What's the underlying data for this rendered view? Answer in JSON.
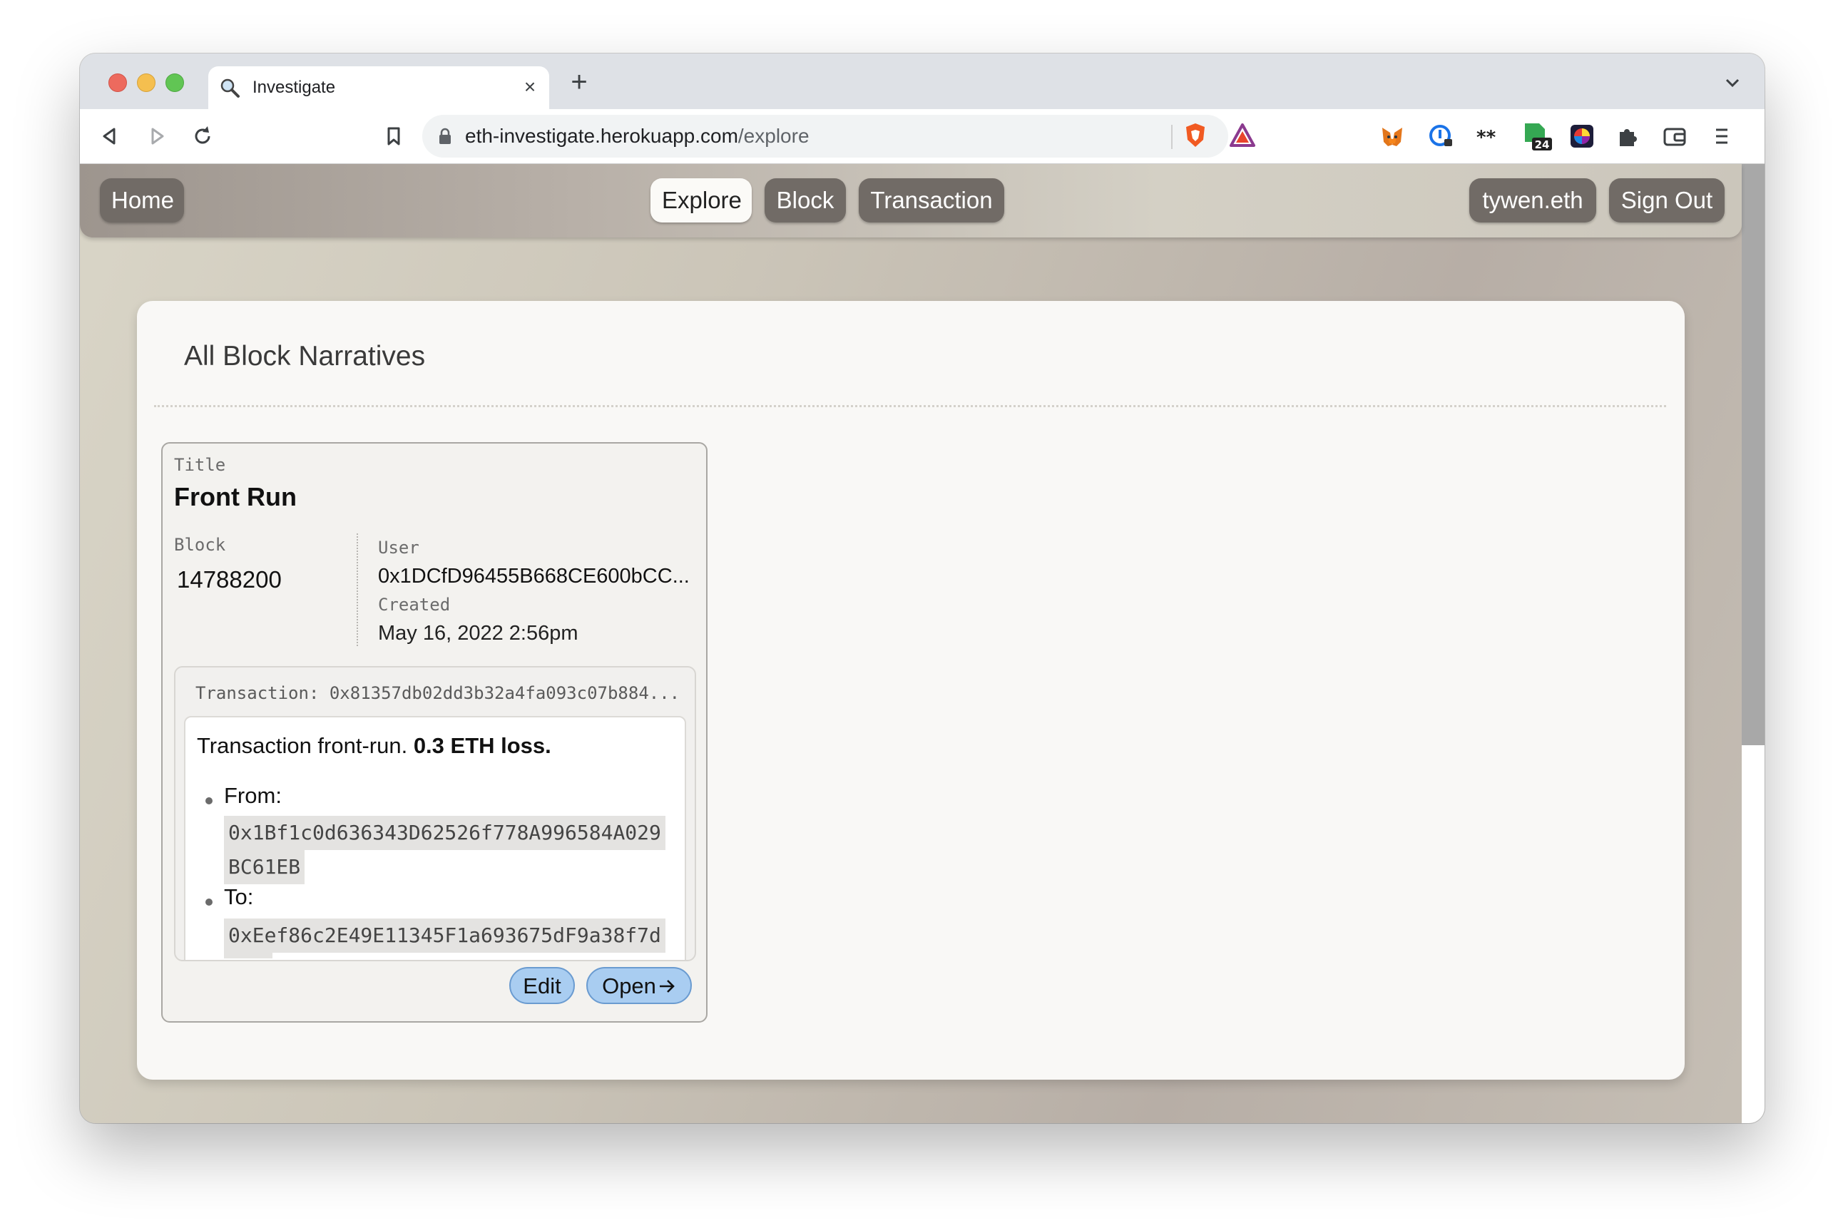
{
  "browser": {
    "tab_title": "Investigate",
    "url_host": "eth-investigate.herokuapp.com",
    "url_path": "/explore",
    "extension_badge": "24"
  },
  "nav": {
    "home": "Home",
    "explore": "Explore",
    "block": "Block",
    "transaction": "Transaction",
    "user": "tywen.eth",
    "sign_out": "Sign Out"
  },
  "page": {
    "heading": "All Block Narratives"
  },
  "narrative": {
    "title_label": "Title",
    "title": "Front Run",
    "block_label": "Block",
    "block": "14788200",
    "user_label": "User",
    "user": "0x1DCfD96455B668CE600bCC...",
    "created_label": "Created",
    "created": "May 16, 2022 2:56pm",
    "transaction_line": "Transaction: 0x81357db02dd3b32a4fa093c07b884...",
    "summary_text": "Transaction front-run. ",
    "summary_bold": "0.3 ETH loss.",
    "from_label": "From:",
    "from_addr_line1": "0x1Bf1c0d636343D62526f778A996584A029",
    "from_addr_line2": "BC61EB",
    "to_label": "To:",
    "to_addr_line1": "0xEef86c2E49E11345F1a693675dF9a38f7d",
    "edit": "Edit",
    "open": "Open"
  }
}
